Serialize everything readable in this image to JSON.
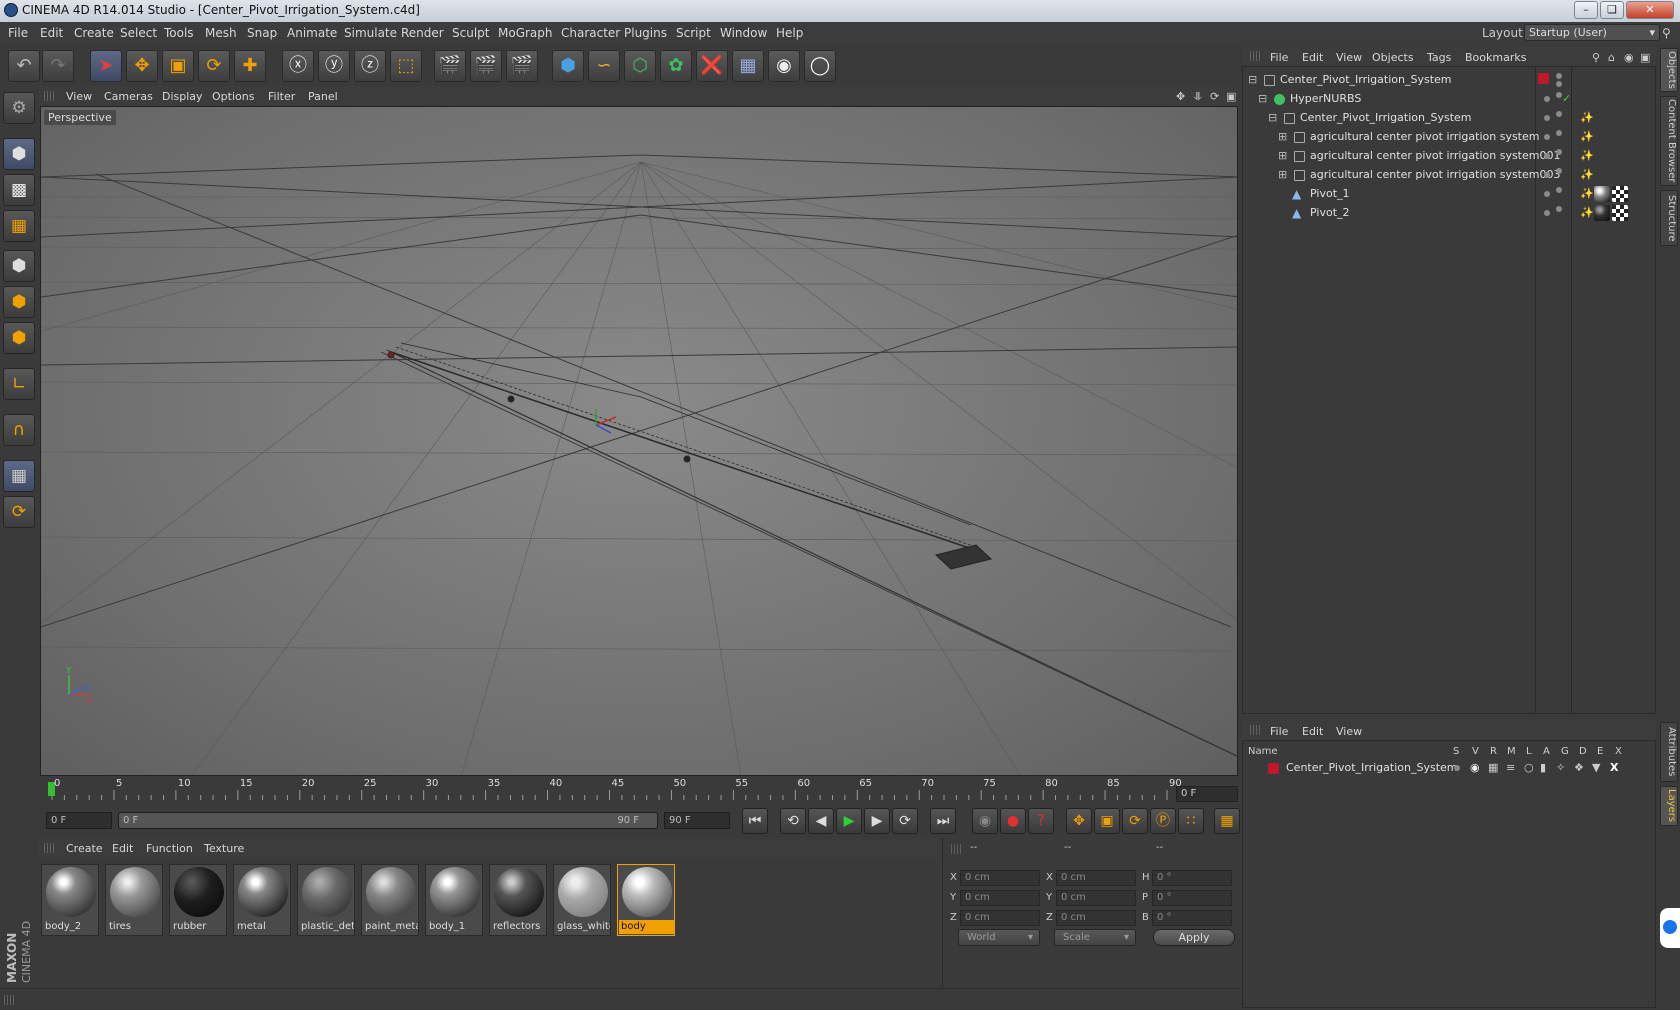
{
  "window": {
    "title": "CINEMA 4D R14.014 Studio - [Center_Pivot_Irrigation_System.c4d]"
  },
  "menubar": {
    "items": [
      "File",
      "Edit",
      "Create",
      "Select",
      "Tools",
      "Mesh",
      "Snap",
      "Animate",
      "Simulate",
      "Render",
      "Sculpt",
      "MoGraph",
      "Character",
      "Plugins",
      "Script",
      "Window",
      "Help"
    ],
    "layout_label": "Layout:",
    "layout_value": "Startup (User)"
  },
  "viewport": {
    "menu": [
      "View",
      "Cameras",
      "Display",
      "Options",
      "Filter",
      "Panel"
    ],
    "label": "Perspective"
  },
  "timeline": {
    "ticks": [
      "0",
      "5",
      "10",
      "15",
      "20",
      "25",
      "30",
      "35",
      "40",
      "45",
      "50",
      "55",
      "60",
      "65",
      "70",
      "75",
      "80",
      "85",
      "90"
    ],
    "current_frame": "0 F",
    "start_field": "0 F",
    "range_start": "0 F",
    "range_end": "90 F",
    "end_field": "90 F"
  },
  "materials": {
    "menu": [
      "Create",
      "Edit",
      "Function",
      "Texture"
    ],
    "items": [
      {
        "name": "body_2"
      },
      {
        "name": "tires"
      },
      {
        "name": "rubber"
      },
      {
        "name": "metal"
      },
      {
        "name": "plastic_det"
      },
      {
        "name": "paint_meta"
      },
      {
        "name": "body_1"
      },
      {
        "name": "reflectors"
      },
      {
        "name": "glass_white"
      },
      {
        "name": "body"
      }
    ],
    "active": "body"
  },
  "coordinates": {
    "header": [
      "--",
      "--",
      "--"
    ],
    "rows": [
      {
        "a": "X",
        "av": "0 cm",
        "b": "X",
        "bv": "0 cm",
        "c": "H",
        "cv": "0 °"
      },
      {
        "a": "Y",
        "av": "0 cm",
        "b": "Y",
        "bv": "0 cm",
        "c": "P",
        "cv": "0 °"
      },
      {
        "a": "Z",
        "av": "0 cm",
        "b": "Z",
        "bv": "0 cm",
        "c": "B",
        "cv": "0 °"
      }
    ],
    "mode1": "World",
    "mode2": "Scale",
    "apply": "Apply"
  },
  "objects": {
    "menu": [
      "File",
      "Edit",
      "View",
      "Objects",
      "Tags",
      "Bookmarks"
    ],
    "rows": [
      {
        "name": "Center_Pivot_Irrigation_System"
      },
      {
        "name": "HyperNURBS"
      },
      {
        "name": "Center_Pivot_Irrigation_System"
      },
      {
        "name": "agricultural center pivot irrigation system"
      },
      {
        "name": "agricultural center pivot irrigation system001"
      },
      {
        "name": "agricultural center pivot irrigation system003"
      },
      {
        "name": "Pivot_1"
      },
      {
        "name": "Pivot_2"
      }
    ]
  },
  "layers": {
    "menu": [
      "File",
      "Edit",
      "View"
    ],
    "columns": [
      "Name",
      "S",
      "V",
      "R",
      "M",
      "L",
      "A",
      "G",
      "D",
      "E",
      "X"
    ],
    "rows": [
      {
        "name": "Center_Pivot_Irrigation_System"
      }
    ]
  },
  "sidetabs": [
    "Objects",
    "Content Browser",
    "Structure",
    "Attributes",
    "Layers"
  ],
  "colors": {
    "accent": "#f0a000",
    "selection": "#5e6a85",
    "layer_color": "#c0182a"
  }
}
